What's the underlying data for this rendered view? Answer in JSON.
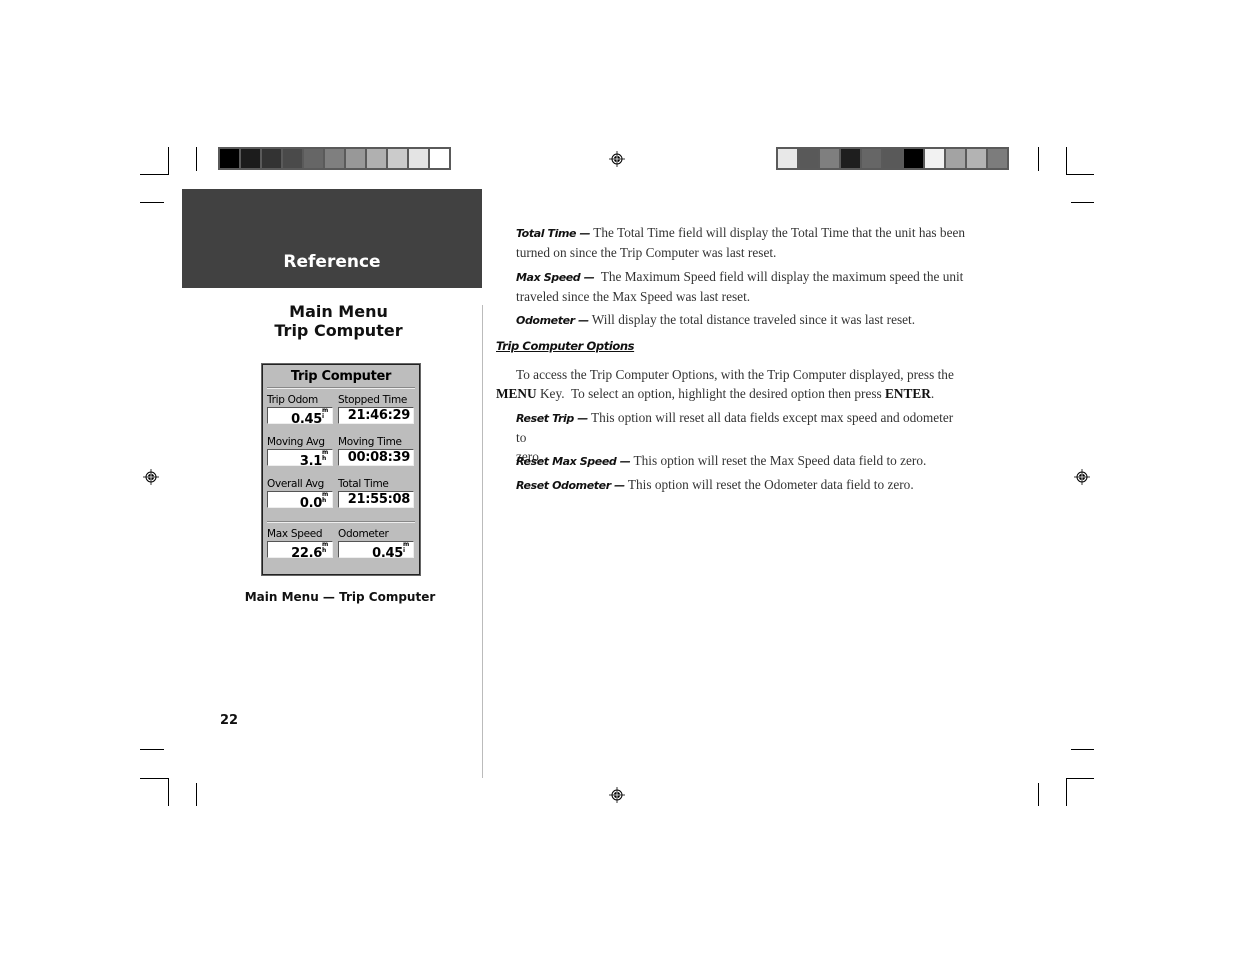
{
  "header": {
    "section_tab": "Reference",
    "side_title_line1": "Main Menu",
    "side_title_line2": "Trip Computer"
  },
  "color_bars": {
    "left": [
      "#000000",
      "#1c1c1c",
      "#333333",
      "#4a4a4a",
      "#666666",
      "#7f7f7f",
      "#989898",
      "#b0b0b0",
      "#cbcbcb",
      "#e4e4e4",
      "#ffffff"
    ],
    "right": [
      "#e8e8e8",
      "#595959",
      "#7f7f7f",
      "#1e1e1e",
      "#666666",
      "#595959",
      "#000000",
      "#f2f2f2",
      "#a3a3a3",
      "#b3b3b3",
      "#7c7c7c"
    ]
  },
  "device_screen": {
    "title": "Trip Computer",
    "fields": [
      {
        "label": "Trip Odom",
        "value": "0.45",
        "unit_top": "m",
        "unit_bottom": "i"
      },
      {
        "label": "Stopped Time",
        "value": "21:46:29",
        "unit_top": "",
        "unit_bottom": ""
      },
      {
        "label": "Moving Avg",
        "value": "3.1",
        "unit_top": "m",
        "unit_bottom": "h"
      },
      {
        "label": "Moving Time",
        "value": "00:08:39",
        "unit_top": "",
        "unit_bottom": ""
      },
      {
        "label": "Overall Avg",
        "value": "0.0",
        "unit_top": "m",
        "unit_bottom": "h"
      },
      {
        "label": "Total Time",
        "value": "21:55:08",
        "unit_top": "",
        "unit_bottom": ""
      },
      {
        "label": "Max Speed",
        "value": "22.6",
        "unit_top": "m",
        "unit_bottom": "h"
      },
      {
        "label": "Odometer",
        "value": "0.45",
        "unit_top": "m",
        "unit_bottom": "i"
      }
    ]
  },
  "figure_caption": "Main Menu — Trip Computer",
  "page_number": "22",
  "content": {
    "total_time": {
      "term": "Total Time —",
      "text_line1": " The Total Time field will display the Total Time that the unit has been",
      "text_line2": "turned on since the Trip Computer was last reset."
    },
    "max_speed": {
      "term": "Max Speed —",
      "text_line1": "  The Maximum Speed field will display the maximum speed the unit",
      "text_line2": "traveled since the Max Speed was last reset."
    },
    "odometer": {
      "term": "Odometer —",
      "text_line1": " Will display the total distance traveled since it was last reset."
    },
    "options_heading": "Trip Computer Options",
    "options_intro_line1": "To access the Trip Computer Options, with the Trip Computer displayed, press the",
    "options_intro_key1": "MENU",
    "options_intro_line2a": " Key.  To select an option, highlight the desired option then press ",
    "options_intro_key2": "ENTER",
    "options_intro_line2b": ".",
    "reset_trip": {
      "term": "Reset Trip —",
      "text_line1": " This option will reset all data fields except max speed and odometer to",
      "text_line2": "zero."
    },
    "reset_max_speed": {
      "term": "Reset Max Speed —",
      "text_line1": " This option will reset the Max Speed data field to zero."
    },
    "reset_odometer": {
      "term": "Reset Odometer —",
      "text_line1": " This option will reset the Odometer data field to zero."
    }
  }
}
